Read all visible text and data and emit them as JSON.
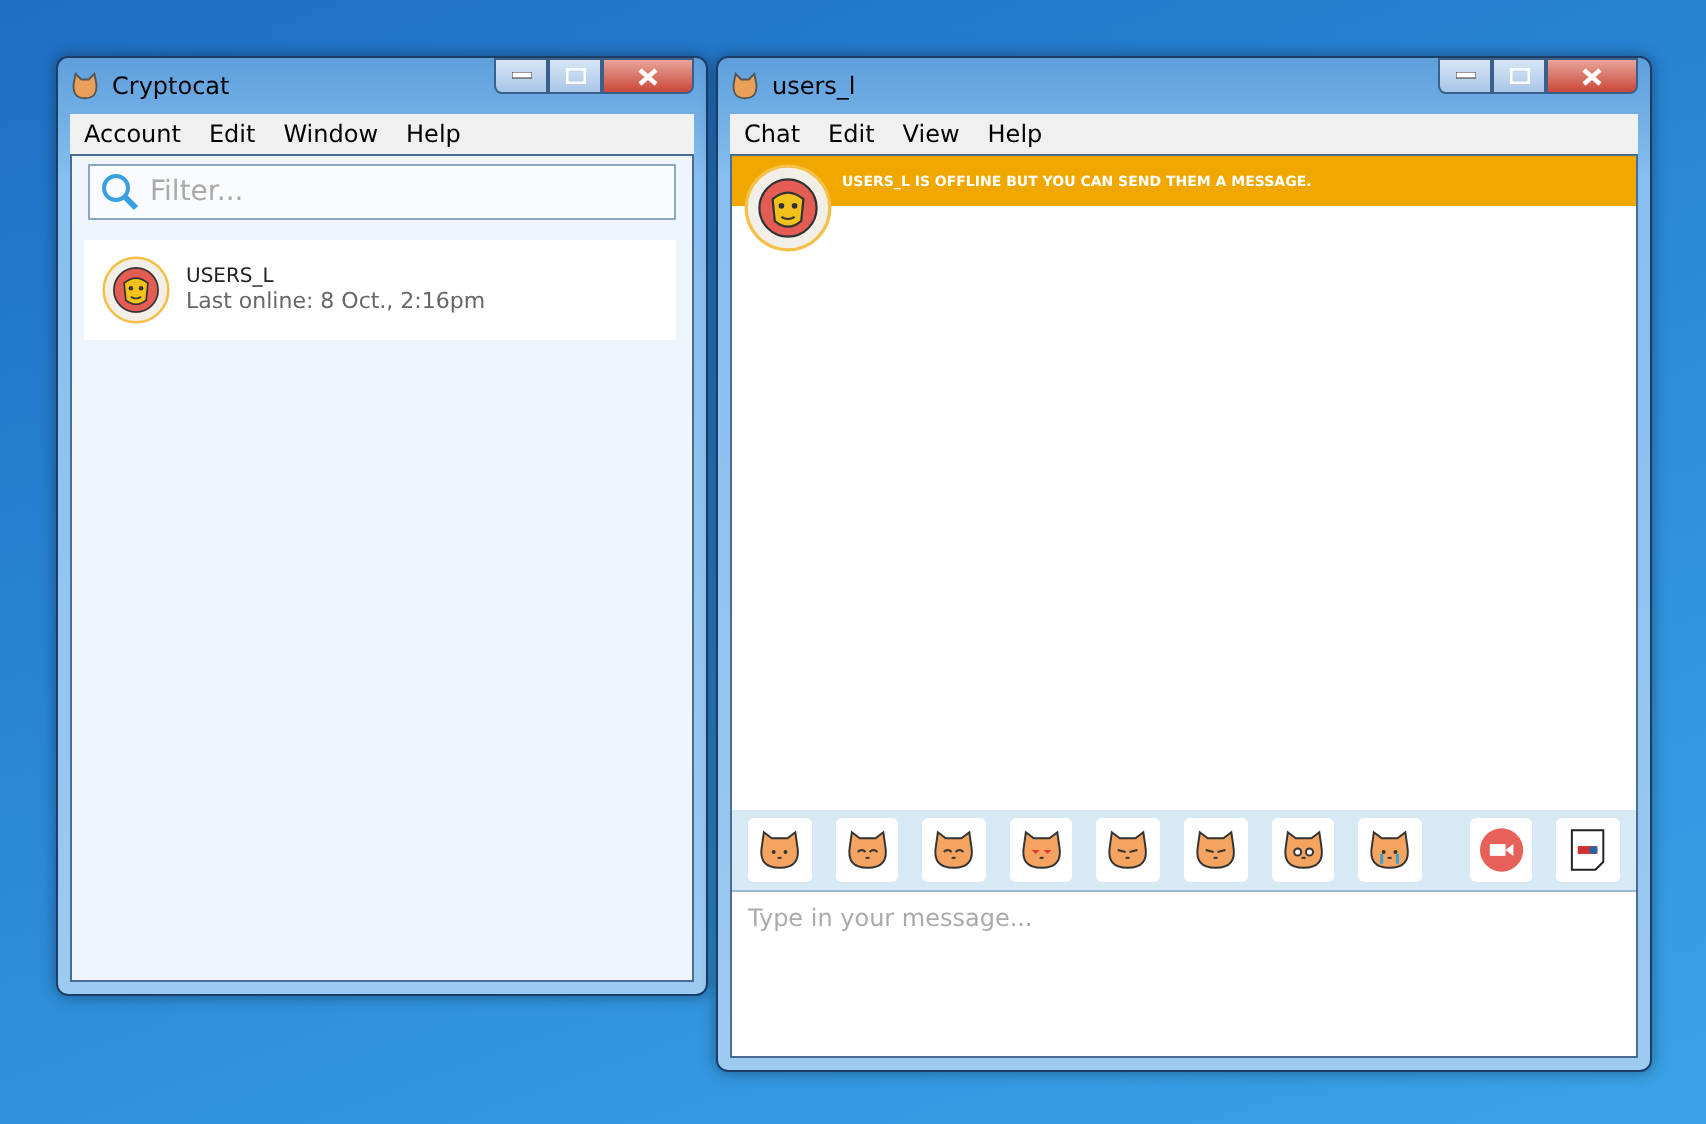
{
  "windows": [
    {
      "title": "Cryptocat",
      "menu": [
        "Account",
        "Edit",
        "Window",
        "Help"
      ],
      "search": {
        "placeholder": "Filter..."
      },
      "contacts": [
        {
          "name": "USERS_L",
          "status": "Last online: 8 Oct., 2:16pm"
        }
      ]
    },
    {
      "title": "users_l",
      "menu": [
        "Chat",
        "Edit",
        "View",
        "Help"
      ],
      "notice": "USERS_L IS OFFLINE BUT YOU CAN SEND THEM A MESSAGE.",
      "composer": {
        "placeholder": "Type in your message..."
      }
    }
  ]
}
